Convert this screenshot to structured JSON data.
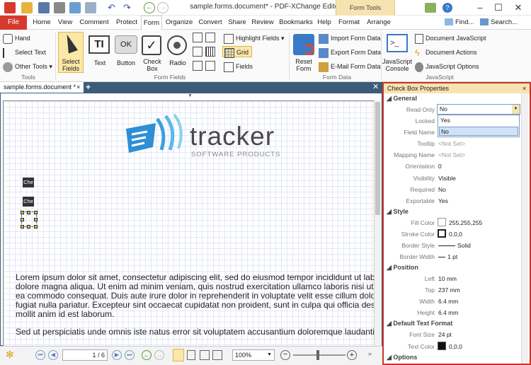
{
  "window": {
    "title": "sample.forms.document* - PDF-XChange Editor",
    "contextual_tab": "Form Tools"
  },
  "quick_actions": {
    "find": "Find...",
    "search": "Search..."
  },
  "menu": {
    "file": "File",
    "tabs": [
      "Home",
      "View",
      "Comment",
      "Protect",
      "Form",
      "Organize",
      "Convert",
      "Share",
      "Review",
      "Bookmarks",
      "Help",
      "Format",
      "Arrange"
    ]
  },
  "ribbon": {
    "tools": {
      "hand": "Hand",
      "select_text": "Select Text",
      "other_tools": "Other Tools",
      "group": "Tools"
    },
    "fields": {
      "select_fields": "Select Fields",
      "text": "Text",
      "button": "Button",
      "check_box": "Check Box",
      "radio": "Radio",
      "highlight_fields": "Highlight Fields",
      "grid": "Grid",
      "fields": "Fields",
      "group": "Form Fields",
      "ok_label": "OK"
    },
    "data": {
      "reset_form": "Reset Form",
      "import": "Import Form Data",
      "export": "Export Form Data",
      "email": "E-Mail Form Data",
      "group": "Form Data"
    },
    "js": {
      "console": "JavaScript Console",
      "document_js": "Document JavaScript",
      "document_actions": "Document Actions",
      "js_options": "JavaScript Options",
      "group": "JavaScript"
    }
  },
  "document": {
    "tab_title": "sample.forms.document *",
    "logo_main": "tracker",
    "logo_sub": "SOFTWARE PRODUCTS",
    "field_labels": [
      "Che",
      "Che"
    ],
    "para1": [
      "Lorem ipsum dolor sit amet, consectetur adipiscing elit, sed do eiusmod tempor incididunt ut labor",
      "dolore magna aliqua. Ut enim ad minim veniam, quis nostrud exercitation ullamco laboris nisi ut aliqui",
      "ea commodo consequat. Duis aute irure dolor in reprehenderit in voluptate velit esse cillum dolore",
      "fugiat nulla pariatur. Excepteur sint occaecat cupidatat non proident, sunt in culpa qui officia dese",
      "mollit anim id est laborum."
    ],
    "para2": "Sed ut perspiciatis unde omnis iste natus error sit voluptatem accusantium doloremque laudantium, to"
  },
  "statusbar": {
    "page": "1",
    "page_total": "/ 6",
    "zoom": "100%"
  },
  "panel": {
    "title": "Check Box Properties",
    "sections": {
      "general": "General",
      "style": "Style",
      "position": "Position",
      "text_format": "Default Text Format",
      "options": "Options"
    },
    "general": [
      {
        "label": "Read Only",
        "value": "No"
      },
      {
        "label": "Locked",
        "value": ""
      },
      {
        "label": "Field Name",
        "value": ""
      },
      {
        "label": "Tooltip",
        "value": "<Not Set>"
      },
      {
        "label": "Mapping Name",
        "value": "<Not Set>"
      },
      {
        "label": "Orientation",
        "value": "0"
      },
      {
        "label": "Visibility",
        "value": "Visible"
      },
      {
        "label": "Required",
        "value": "No"
      },
      {
        "label": "Exportable",
        "value": "Yes"
      }
    ],
    "dropdown_options": [
      "Yes",
      "No"
    ],
    "style": [
      {
        "label": "Fill Color",
        "value": "255,255,255"
      },
      {
        "label": "Stroke Color",
        "value": "0,0,0"
      },
      {
        "label": "Border Style",
        "value": "Solid"
      },
      {
        "label": "Border Width",
        "value": "1 pt"
      }
    ],
    "position": [
      {
        "label": "Left",
        "value": "10 mm"
      },
      {
        "label": "Top",
        "value": "237 mm"
      },
      {
        "label": "Width",
        "value": "6.4 mm"
      },
      {
        "label": "Height",
        "value": "6.4 mm"
      }
    ],
    "text_format": [
      {
        "label": "Font Size",
        "value": "24 pt"
      },
      {
        "label": "Text Color",
        "value": "0,0,0"
      }
    ]
  },
  "colors": {
    "accent_red": "#d53a2d",
    "context_tab": "#f6e3b0",
    "doc_frame": "#3c5a7a",
    "logo_blue": "#2e8fd4"
  }
}
